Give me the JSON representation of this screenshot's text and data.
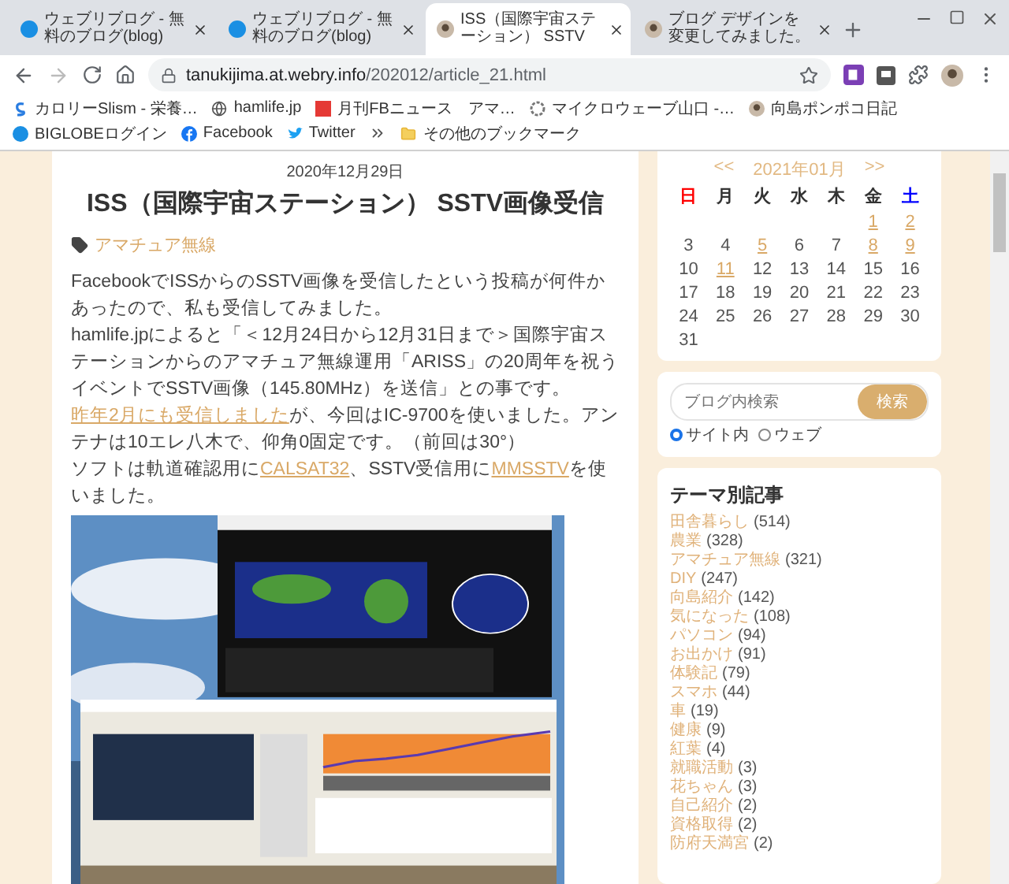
{
  "browser": {
    "tabs": [
      {
        "title": "ウェブリブログ - 無料のブログ(blog)",
        "selected": false
      },
      {
        "title": "ウェブリブログ - 無料のブログ(blog)",
        "selected": false
      },
      {
        "title": "ISS（国際宇宙ステーション） SSTV",
        "selected": true
      },
      {
        "title": "ブログ デザインを変更してみました。",
        "selected": false
      }
    ],
    "address": {
      "host": "tanukijima.at.webry.info",
      "path": "/202012/article_21.html"
    },
    "bookmarks": [
      {
        "label": "カロリーSlism - 栄養…"
      },
      {
        "label": "hamlife.jp"
      },
      {
        "label": "月刊FBニュース　アマ…"
      },
      {
        "label": "マイクロウェーブ山口 -…"
      },
      {
        "label": "向島ポンポコ日記"
      },
      {
        "label": "BIGLOBEログイン"
      },
      {
        "label": "Facebook"
      },
      {
        "label": "Twitter"
      }
    ],
    "more_bookmarks": "その他のブックマーク"
  },
  "article": {
    "date": "2020年12月29日",
    "title": "ISS（国際宇宙ステーション） SSTV画像受信",
    "tag": "アマチュア無線",
    "paragraphs": [
      [
        {
          "text": "FacebookでISSからのSSTV画像を受信したという投稿が何件かあったので、私も受信してみました。",
          "link": false
        }
      ],
      [
        {
          "text": "hamlife.jpによると「＜12月24日から12月31日まで＞国際宇宙ステーションからのアマチュア無線運用「ARISS」の20周年を祝うイベントでSSTV画像（145.80MHz）を送信」との事です。",
          "link": false
        }
      ],
      [
        {
          "text": "昨年2月にも受信しました",
          "link": true
        },
        {
          "text": "が、今回はIC-9700を使いました。アンテナは10エレ八木で、仰角0固定です。（前回は30°）",
          "link": false
        }
      ],
      [
        {
          "text": "ソフトは軌道確認用に",
          "link": false
        },
        {
          "text": "CALSAT32",
          "link": true
        },
        {
          "text": "、SSTV受信用に",
          "link": false
        },
        {
          "text": "MMSSTV",
          "link": true
        },
        {
          "text": "を使いました。",
          "link": false
        }
      ]
    ]
  },
  "sidebar": {
    "calendar": {
      "prev": "<<",
      "month": "2021年01月",
      "next": ">>",
      "weekdays": [
        {
          "label": "日",
          "color": "#ff0000"
        },
        {
          "label": "月",
          "color": "#333333"
        },
        {
          "label": "火",
          "color": "#333333"
        },
        {
          "label": "水",
          "color": "#333333"
        },
        {
          "label": "木",
          "color": "#333333"
        },
        {
          "label": "金",
          "color": "#333333"
        },
        {
          "label": "土",
          "color": "#0000ff"
        }
      ],
      "weeks": [
        [
          {
            "day": "1",
            "link": true
          },
          {
            "day": "2",
            "link": true
          }
        ],
        [
          {
            "day": "3",
            "link": false
          },
          {
            "day": "4",
            "link": false
          },
          {
            "day": "5",
            "link": true
          },
          {
            "day": "6",
            "link": false
          },
          {
            "day": "7",
            "link": false
          },
          {
            "day": "8",
            "link": true
          },
          {
            "day": "9",
            "link": true
          }
        ],
        [
          {
            "day": "10",
            "link": false
          },
          {
            "day": "11",
            "link": true
          },
          {
            "day": "12",
            "link": false
          },
          {
            "day": "13",
            "link": false
          },
          {
            "day": "14",
            "link": false
          },
          {
            "day": "15",
            "link": false
          },
          {
            "day": "16",
            "link": false
          }
        ],
        [
          {
            "day": "17",
            "link": false
          },
          {
            "day": "18",
            "link": false
          },
          {
            "day": "19",
            "link": false
          },
          {
            "day": "20",
            "link": false
          },
          {
            "day": "21",
            "link": false
          },
          {
            "day": "22",
            "link": false
          },
          {
            "day": "23",
            "link": false
          }
        ],
        [
          {
            "day": "24",
            "link": false
          },
          {
            "day": "25",
            "link": false
          },
          {
            "day": "26",
            "link": false
          },
          {
            "day": "27",
            "link": false
          },
          {
            "day": "28",
            "link": false
          },
          {
            "day": "29",
            "link": false
          },
          {
            "day": "30",
            "link": false
          }
        ],
        [
          {
            "day": "31",
            "link": false
          }
        ]
      ]
    },
    "search": {
      "placeholder": "ブログ内検索",
      "button": "検索",
      "scopes": [
        {
          "label": "サイト内",
          "selected": true
        },
        {
          "label": "ウェブ",
          "selected": false
        }
      ]
    },
    "themes": {
      "title": "テーマ別記事",
      "items": [
        {
          "name": "田舎暮らし",
          "count": "(514)"
        },
        {
          "name": "農業",
          "count": "(328)"
        },
        {
          "name": "アマチュア無線",
          "count": "(321)"
        },
        {
          "name": "DIY",
          "count": "(247)"
        },
        {
          "name": "向島紹介",
          "count": "(142)"
        },
        {
          "name": "気になった",
          "count": "(108)"
        },
        {
          "name": "パソコン",
          "count": "(94)"
        },
        {
          "name": "お出かけ",
          "count": "(91)"
        },
        {
          "name": "体験記",
          "count": "(79)"
        },
        {
          "name": "スマホ",
          "count": "(44)"
        },
        {
          "name": "車",
          "count": "(19)"
        },
        {
          "name": "健康",
          "count": "(9)"
        },
        {
          "name": "紅葉",
          "count": "(4)"
        },
        {
          "name": "就職活動",
          "count": "(3)"
        },
        {
          "name": "花ちゃん",
          "count": "(3)"
        },
        {
          "name": "自己紹介",
          "count": "(2)"
        },
        {
          "name": "資格取得",
          "count": "(2)"
        },
        {
          "name": "防府天満宮",
          "count": "(2)"
        }
      ]
    }
  }
}
